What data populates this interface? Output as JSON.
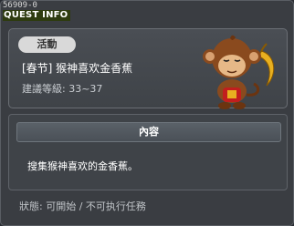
{
  "window": {
    "id_label": "56909-0",
    "title": "QUEST INFO",
    "close_glyph": "×",
    "close_icon": "close-icon"
  },
  "quest": {
    "badge": "活動",
    "name": "[春节] 猴神喜欢金香蕉",
    "level_label": "建議等級: 33~37",
    "portrait_icon": "monkey-npc-icon"
  },
  "content": {
    "header": "內容",
    "text": "搜集猴神喜欢的金香蕉。"
  },
  "status": {
    "text": "狀態: 可開始 / 不可执行任務"
  },
  "colors": {
    "window_bg": "#3a3d42",
    "panel_bg": "#4a4e54",
    "badge_bg": "#d9d9d9",
    "title_highlight": "#2e3b10",
    "monkey_brown": "#8a4a1e",
    "banana_gold": "#e8b020"
  }
}
